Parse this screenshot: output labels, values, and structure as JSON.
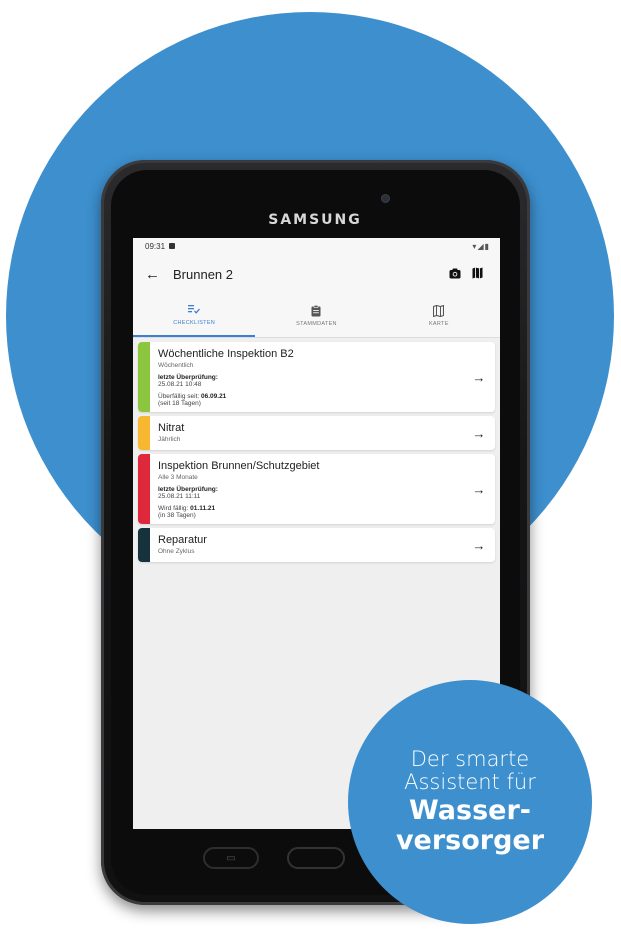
{
  "colors": {
    "background_circle": "#3d8fce",
    "accent": "#3a7fd0",
    "green": "#8cc63f",
    "orange": "#f7b731",
    "red": "#e0283c",
    "dark": "#15323d"
  },
  "device": {
    "brand": "SAMSUNG"
  },
  "statusbar": {
    "time": "09:31",
    "icons": "▾◢▮"
  },
  "appbar": {
    "back_icon": "arrow-left-icon",
    "title": "Brunnen 2",
    "camera_icon": "camera-icon",
    "map_icon": "map-icon"
  },
  "tabs": [
    {
      "label": "CHECKLISTEN",
      "icon": "checklist-icon",
      "active": true
    },
    {
      "label": "STAMMDATEN",
      "icon": "clipboard-icon",
      "active": false
    },
    {
      "label": "KARTE",
      "icon": "map-icon",
      "active": false
    }
  ],
  "checklists": [
    {
      "title": "Wöchentliche Inspektion B2",
      "interval": "Wöchentlich",
      "last_label": "letzte Überprüfung:",
      "last_value": "25.08.21 10:48",
      "due_prefix": "Überfällig seit: ",
      "due_date": "06.09.21",
      "due_days": "(seit 18 Tagen)",
      "color": "#8cc63f"
    },
    {
      "title": "Nitrat",
      "interval": "Jährlich",
      "color": "#f7b731"
    },
    {
      "title": "Inspektion Brunnen/Schutzgebiet",
      "interval": "Alle 3 Monate",
      "last_label": "letzte Überprüfung:",
      "last_value": "25.08.21 11:11",
      "due_prefix": "Wird fällig: ",
      "due_date": "01.11.21",
      "due_days": "(in 38 Tagen)",
      "color": "#e0283c"
    },
    {
      "title": "Reparatur",
      "interval": "Ohne Zyklus",
      "color": "#15323d"
    }
  ],
  "badge": {
    "line1": "Der smarte",
    "line2": "Assistent für",
    "line3": "Wasser-",
    "line4": "versorger"
  }
}
